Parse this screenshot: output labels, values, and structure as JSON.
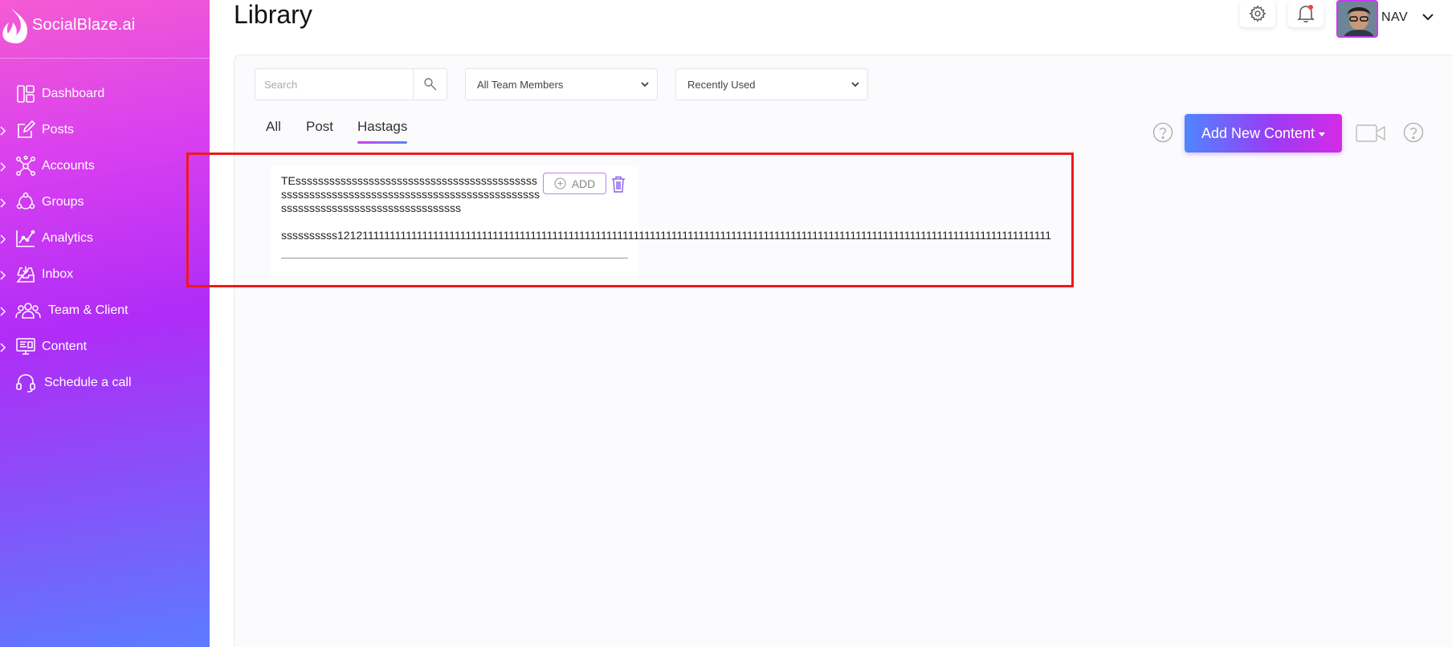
{
  "brand": {
    "name": "SocialBlaze.ai"
  },
  "sidebar": {
    "items": [
      {
        "label": "Dashboard",
        "icon": "dashboard-icon",
        "expandable": false
      },
      {
        "label": "Posts",
        "icon": "edit-icon",
        "expandable": true
      },
      {
        "label": "Accounts",
        "icon": "network-icon",
        "expandable": true
      },
      {
        "label": "Groups",
        "icon": "groups-icon",
        "expandable": true
      },
      {
        "label": "Analytics",
        "icon": "analytics-icon",
        "expandable": true
      },
      {
        "label": "Inbox",
        "icon": "inbox-icon",
        "expandable": true
      },
      {
        "label": "Team & Client",
        "icon": "team-icon",
        "expandable": true
      },
      {
        "label": "Content",
        "icon": "content-icon",
        "expandable": true
      },
      {
        "label": "Schedule a call",
        "icon": "headset-icon",
        "expandable": false
      }
    ]
  },
  "header": {
    "title": "Library",
    "user": {
      "name": "NAV"
    },
    "settings_icon": "gear-icon",
    "notifications_icon": "bell-icon",
    "notification_dot_color": "#f0413b"
  },
  "filters": {
    "search": {
      "placeholder": "Search",
      "value": ""
    },
    "team_select": {
      "value": "All Team Members"
    },
    "sort_select": {
      "value": "Recently Used"
    }
  },
  "tabs": [
    {
      "label": "All",
      "active": false
    },
    {
      "label": "Post",
      "active": false
    },
    {
      "label": "Hastags",
      "active": true
    }
  ],
  "actions": {
    "add_new_content": "Add New Content"
  },
  "cards": [
    {
      "title": "TEsssssssssssssssssssssssssssssssssssssssssssssssssssssssssssssssssssssssssssssssssssssssssssssssssssssssssssssssssssssssss",
      "add_label": "ADD",
      "tags": "ssssssssss12121111111111111111111111111111111111111111111111111111111111111111111111111111111111111111111111111111111111111111111111111111111"
    }
  ],
  "colors": {
    "accent_pink": "#d52be6",
    "accent_blue": "#4f86ff",
    "highlight_red": "#ee1a1a"
  }
}
